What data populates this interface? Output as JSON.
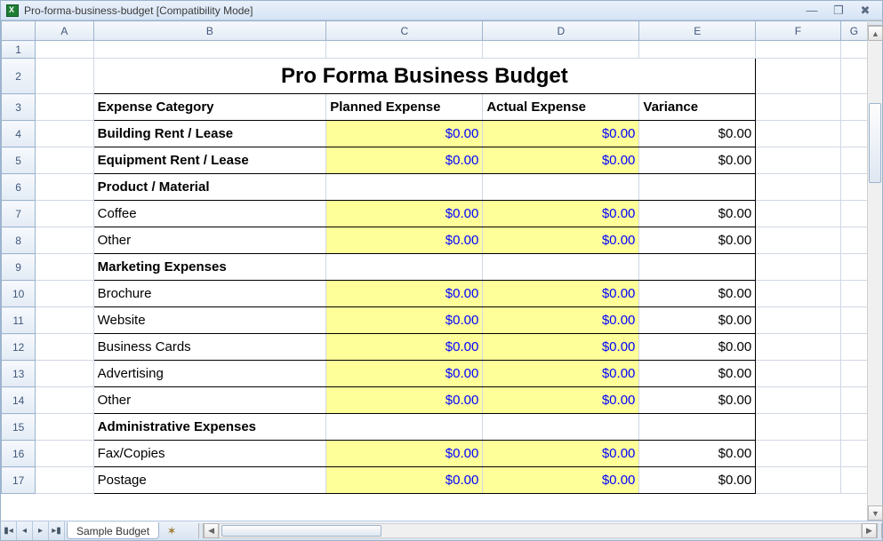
{
  "window": {
    "title": "Pro-forma-business-budget  [Compatibility Mode]"
  },
  "columns": [
    "A",
    "B",
    "C",
    "D",
    "E",
    "F",
    "G"
  ],
  "sheet_title": "Pro Forma Business Budget",
  "headers": {
    "category": "Expense Category",
    "planned": "Planned Expense",
    "actual": "Actual Expense",
    "variance": "Variance"
  },
  "rows": [
    {
      "n": 4,
      "label": "Building Rent / Lease",
      "bold": true,
      "planned": "$0.00",
      "actual": "$0.00",
      "variance": "$0.00"
    },
    {
      "n": 5,
      "label": "Equipment Rent / Lease",
      "bold": true,
      "planned": "$0.00",
      "actual": "$0.00",
      "variance": "$0.00"
    },
    {
      "n": 6,
      "label": "Product / Material",
      "bold": true,
      "section": true
    },
    {
      "n": 7,
      "label": "Coffee",
      "bold": false,
      "planned": "$0.00",
      "actual": "$0.00",
      "variance": "$0.00"
    },
    {
      "n": 8,
      "label": "Other",
      "bold": false,
      "planned": "$0.00",
      "actual": "$0.00",
      "variance": "$0.00"
    },
    {
      "n": 9,
      "label": "Marketing Expenses",
      "bold": true,
      "section": true
    },
    {
      "n": 10,
      "label": "Brochure",
      "bold": false,
      "planned": "$0.00",
      "actual": "$0.00",
      "variance": "$0.00"
    },
    {
      "n": 11,
      "label": "Website",
      "bold": false,
      "planned": "$0.00",
      "actual": "$0.00",
      "variance": "$0.00"
    },
    {
      "n": 12,
      "label": "Business Cards",
      "bold": false,
      "planned": "$0.00",
      "actual": "$0.00",
      "variance": "$0.00"
    },
    {
      "n": 13,
      "label": "Advertising",
      "bold": false,
      "planned": "$0.00",
      "actual": "$0.00",
      "variance": "$0.00"
    },
    {
      "n": 14,
      "label": "Other",
      "bold": false,
      "planned": "$0.00",
      "actual": "$0.00",
      "variance": "$0.00"
    },
    {
      "n": 15,
      "label": "Administrative Expenses",
      "bold": true,
      "section": true
    },
    {
      "n": 16,
      "label": "Fax/Copies",
      "bold": false,
      "planned": "$0.00",
      "actual": "$0.00",
      "variance": "$0.00"
    },
    {
      "n": 17,
      "label": "Postage",
      "bold": false,
      "planned": "$0.00",
      "actual": "$0.00",
      "variance": "$0.00"
    }
  ],
  "tab": {
    "name": "Sample Budget"
  },
  "col_widths": {
    "rowhdr": 38,
    "A": 65,
    "B": 260,
    "C": 175,
    "D": 175,
    "E": 130,
    "F": 95,
    "G": 30
  }
}
